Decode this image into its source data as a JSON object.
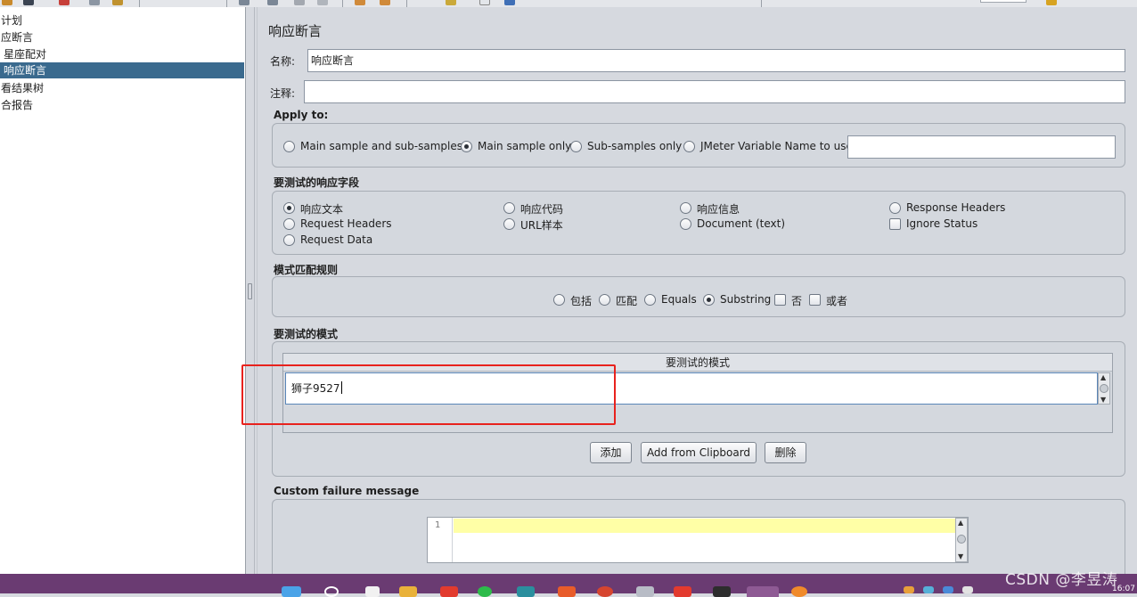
{
  "tree": {
    "items": [
      {
        "label": "计划",
        "selected": false
      },
      {
        "label": "应断言",
        "selected": false
      },
      {
        "label": "星座配对",
        "selected": false
      },
      {
        "label": "响应断言",
        "selected": true
      },
      {
        "label": "看结果树",
        "selected": false
      },
      {
        "label": "合报告",
        "selected": false
      }
    ]
  },
  "panel": {
    "title": "响应断言",
    "name_label": "名称:",
    "name_value": "响应断言",
    "comment_label": "注释:",
    "comment_value": ""
  },
  "apply_to": {
    "title": "Apply to:",
    "options": [
      "Main sample and sub-samples",
      "Main sample only",
      "Sub-samples only",
      "JMeter Variable Name to use"
    ],
    "selected": "Main sample only",
    "variable_value": ""
  },
  "response_field": {
    "title": "要测试的响应字段",
    "radios": [
      "响应文本",
      "响应代码",
      "响应信息",
      "Response Headers",
      "Request Headers",
      "URL样本",
      "Document (text)",
      "Request Data"
    ],
    "selected": "响应文本",
    "ignore_status_label": "Ignore Status",
    "ignore_status_checked": false
  },
  "pattern_rules": {
    "title": "模式匹配规则",
    "radios": [
      "包括",
      "匹配",
      "Equals",
      "Substring"
    ],
    "selected": "Substring",
    "checkboxes": [
      "否",
      "或者"
    ],
    "checked": []
  },
  "patterns": {
    "title": "要测试的模式",
    "column_header": "要测试的模式",
    "rows": [
      "狮子9527"
    ],
    "buttons": {
      "add": "添加",
      "add_clipboard": "Add from Clipboard",
      "delete": "删除"
    }
  },
  "failure_message": {
    "title": "Custom failure message",
    "line_number": "1",
    "value": ""
  },
  "watermark": "CSDN @李昱涛",
  "clock": "16:07",
  "colors": {
    "selection": "#3a6a8e",
    "highlight_box": "#e8221d",
    "editor_line": "#ffffa6",
    "taskbar": "#6a3b72"
  }
}
